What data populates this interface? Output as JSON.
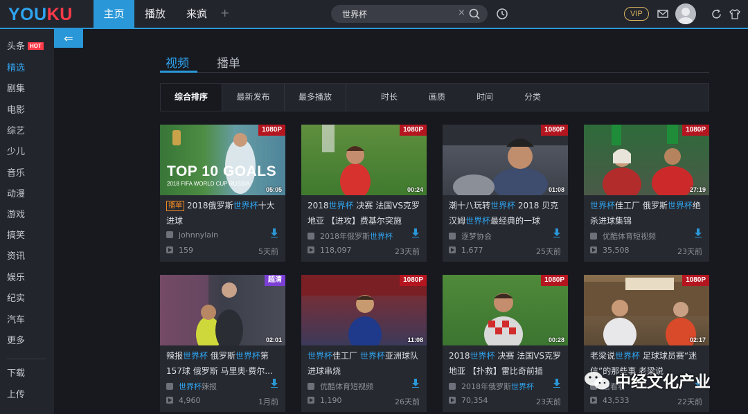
{
  "header": {
    "logo": "YOUKU",
    "tabs": [
      "主页",
      "播放",
      "来疯"
    ],
    "search_value": "世界杯",
    "vip_label": "VIP"
  },
  "sidebar": {
    "items": [
      "头条",
      "精选",
      "剧集",
      "电影",
      "综艺",
      "少儿",
      "音乐",
      "动漫",
      "游戏",
      "搞笑",
      "资讯",
      "娱乐",
      "纪实",
      "汽车",
      "更多"
    ],
    "hot_badge": "HOT",
    "bottom_items": [
      "下载",
      "上传"
    ]
  },
  "tabs": [
    "视频",
    "播单"
  ],
  "filters": [
    "综合排序",
    "最新发布",
    "最多播放",
    "时长",
    "画质",
    "时间",
    "分类"
  ],
  "videos": [
    {
      "badge": "1080P",
      "duration": "05:05",
      "thumb_text": "TOP 10 GOALS",
      "thumb_sub": "2018 FIFA WORLD CUP RUSSIA",
      "tag": "播单",
      "title_parts": [
        "2018俄罗斯",
        "世界杯",
        "十大进球"
      ],
      "author": "johnnylain",
      "views": "159",
      "ago": "5天前"
    },
    {
      "badge": "1080P",
      "duration": "00:24",
      "title_parts": [
        "2018",
        "世界杯",
        " 决赛 法国VS克罗地亚 【进攻】费基尔突施"
      ],
      "author_parts": [
        "2018年俄罗斯",
        "世界杯"
      ],
      "views": "118,097",
      "ago": "23天前"
    },
    {
      "badge": "1080P",
      "duration": "01:08",
      "title_parts": [
        "潮十八玩转",
        "世界杯",
        " 2018 贝克汉姆",
        "世界杯",
        "最经典的一球"
      ],
      "author": "逐梦协会",
      "views": "1,677",
      "ago": "25天前"
    },
    {
      "badge": "1080P",
      "duration": "27:19",
      "title_parts": [
        "世界杯",
        "佳工厂 俄罗斯",
        "世界杯",
        "绝杀进球集锦"
      ],
      "author": "优酷体育短视频",
      "views": "35,508",
      "ago": "23天前"
    },
    {
      "badge": "超清",
      "duration": "02:01",
      "title_parts": [
        "辣报",
        "世界杯",
        " 俄罗斯",
        "世界杯",
        "第157球 俄罗斯 马里奥·费尔..."
      ],
      "author_parts": [
        "世界杯",
        "辣报"
      ],
      "views": "4,960",
      "ago": "1月前"
    },
    {
      "badge": "1080P",
      "duration": "11:08",
      "title_parts": [
        "世界杯",
        "佳工厂 ",
        "世界杯",
        "亚洲球队进球串烧"
      ],
      "author": "优酷体育短视频",
      "views": "1,190",
      "ago": "26天前"
    },
    {
      "badge": "1080P",
      "duration": "00:28",
      "title_parts": [
        "2018",
        "世界杯",
        " 决赛 法国VS克罗地亚 【扑救】雷比奇前插"
      ],
      "author_parts": [
        "2018年俄罗斯",
        "世界杯"
      ],
      "views": "70,354",
      "ago": "23天前"
    },
    {
      "badge": "1080P",
      "duration": "02:17",
      "title_parts": [
        "老梁说",
        "世界杯",
        " 足球球员赛“迷信”的那些事 老梁说"
      ],
      "author": "唐看看",
      "views": "43,533",
      "ago": "22天前"
    }
  ],
  "watermark": "中经文化产业",
  "colors": {
    "accent": "#2a98d8",
    "badge_red": "#b41620",
    "badge_purple": "#7b3fd6",
    "highlight": "#2fa4ef"
  }
}
